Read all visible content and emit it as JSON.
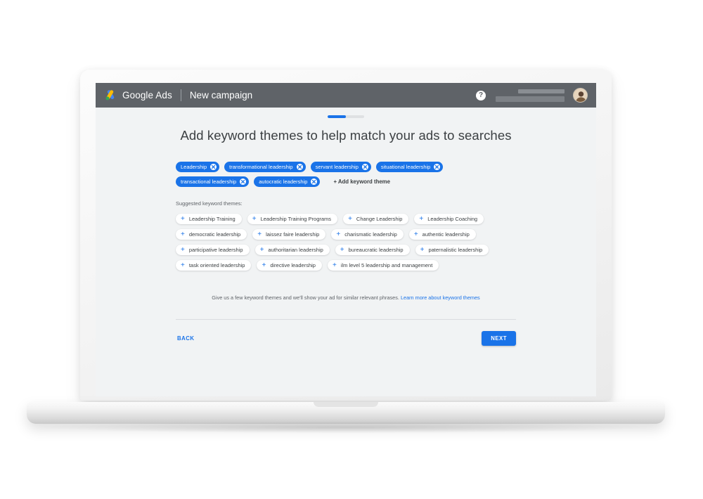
{
  "header": {
    "brand": "Google Ads",
    "campaign": "New campaign",
    "help_icon_glyph": "?",
    "icons": {
      "logo": "google-ads-logo",
      "help": "help-icon",
      "avatar": "user-avatar"
    }
  },
  "progress": {
    "percent": 50
  },
  "main": {
    "title": "Add keyword themes to help match your ads to searches",
    "add_keyword_theme_label": "+ Add keyword theme",
    "suggested_label": "Suggested keyword themes:",
    "helper_text": "Give us a few keyword themes and we'll show your ad for similar relevant phrases.",
    "helper_link": "Learn more about keyword themes",
    "selected_themes": [
      "Leadership",
      "transformational leadership",
      "servant leadership",
      "situational leadership",
      "transactional leadership",
      "autocratic leadership"
    ],
    "suggested_themes": [
      "Leadership Training",
      "Leadership Training Programs",
      "Change Leadership",
      "Leadership Coaching",
      "democratic leadership",
      "laissez faire leadership",
      "charismatic leadership",
      "authentic leadership",
      "participative leadership",
      "authoritarian leadership",
      "bureaucratic leadership",
      "paternalistic leadership",
      "task oriented leadership",
      "directive leadership",
      "ilm level 5 leadership and management"
    ]
  },
  "footer": {
    "back_label": "BACK",
    "next_label": "NEXT"
  },
  "colors": {
    "accent_blue": "#1a73e8",
    "header_gray": "#5f6368",
    "content_bg": "#f1f3f4",
    "text_primary": "#3c4043",
    "text_secondary": "#5f6368"
  }
}
